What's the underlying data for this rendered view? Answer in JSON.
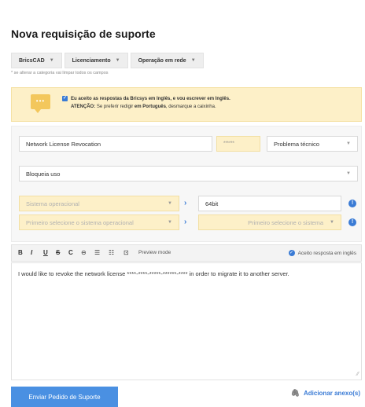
{
  "page": {
    "title": "Nova requisição de suporte"
  },
  "crumbs": {
    "items": [
      {
        "label": "BricsCAD"
      },
      {
        "label": "Licenciamento"
      },
      {
        "label": "Operação em rede"
      }
    ],
    "note": "* se alterar a categoria vai limpar todos os campos"
  },
  "notice": {
    "icon": "chat-bubble-icon",
    "accept_text": "Eu aceito as respostas da Bricsys em Inglês, e vou escrever em Inglês.",
    "attention_label": "ATENÇÃO:",
    "attention_pre": " Se preferir redigir ",
    "attention_bold": "em Português",
    "attention_post": ", desmarque a caixinha."
  },
  "form": {
    "subject_value": "Network License Revocation",
    "serial_value": "******",
    "problem_type": "Problema técnico",
    "severity": "Bloqueia uso",
    "os_placeholder": "Sistema operacional",
    "arch_value": "64bit",
    "os_version_placeholder": "Primeiro selecione o sistema operacional",
    "os_sub_placeholder": "Primeiro selecione o sistema"
  },
  "toolbar": {
    "bold": "B",
    "italic": "I",
    "underline": "U",
    "strike": "S",
    "code": "C",
    "link": "⊖",
    "bullets": "☰",
    "numbered": "☷",
    "preview_icon": "⊡",
    "preview_label": "Preview mode",
    "accept_english": "Aceito resposta em inglês"
  },
  "editor": {
    "text": "I would like to revoke the network license ****-****-*****-******-**** in order to migrate it to another server."
  },
  "actions": {
    "submit": "Enviar Pedido de Suporte",
    "attach": "Adicionar anexo(s)"
  },
  "colors": {
    "accent": "#3a7bd5",
    "notice_bg": "#fdf0c8",
    "submit_bg": "#4a90e2"
  }
}
